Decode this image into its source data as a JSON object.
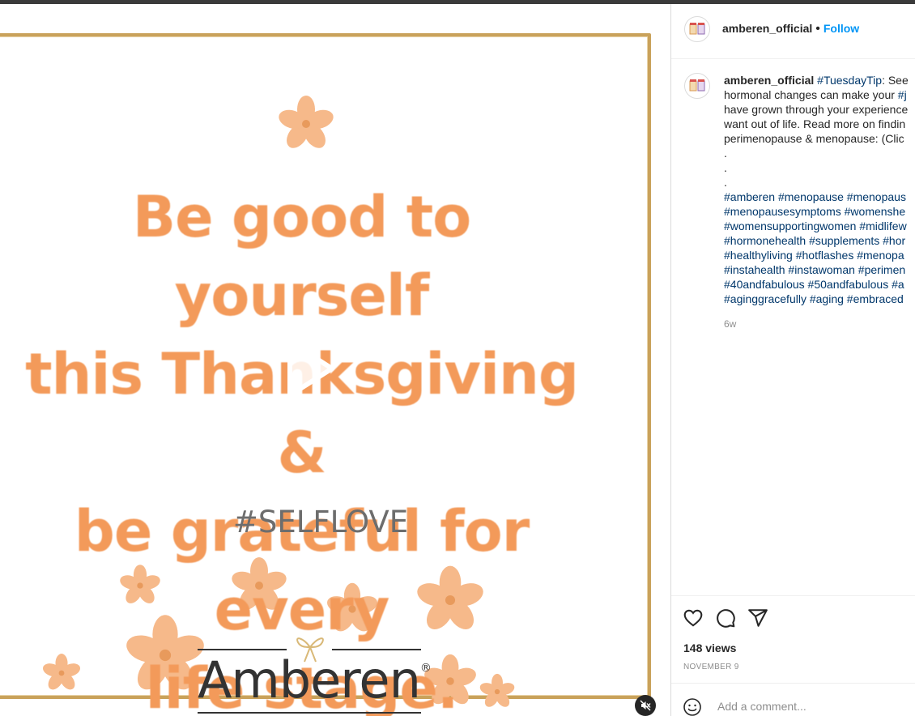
{
  "post": {
    "username": "amberen_official",
    "separator": "•",
    "follow_label": "Follow"
  },
  "media": {
    "quote_lines": [
      "Be good to yourself",
      "this Thanksgiving &",
      "be grateful for every",
      "life stage."
    ],
    "hashtag": "#SELFLOVE",
    "logo_text": "Amberen",
    "logo_mark": "®",
    "play_icon": "play-icon",
    "mute_icon": "muted-speaker-icon"
  },
  "caption": {
    "username": "amberen_official",
    "lines": [
      [
        {
          "t": "#TuesdayTip",
          "tag": true
        },
        {
          "t": ": See ",
          "tag": false
        }
      ],
      [
        {
          "t": "hormonal changes can make your ",
          "tag": false
        },
        {
          "t": "#j",
          "tag": true
        }
      ],
      [
        {
          "t": "have grown through your experience",
          "tag": false
        }
      ],
      [
        {
          "t": "want out of life. Read more on findin",
          "tag": false
        }
      ],
      [
        {
          "t": "perimenopause & menopause: (Clic",
          "tag": false
        }
      ],
      [
        {
          "t": ".",
          "tag": false
        }
      ],
      [
        {
          "t": ".",
          "tag": false
        }
      ],
      [
        {
          "t": ".",
          "tag": false
        }
      ],
      [
        {
          "t": "#amberen",
          "tag": true
        },
        {
          "t": " ",
          "tag": false
        },
        {
          "t": "#menopause",
          "tag": true
        },
        {
          "t": " ",
          "tag": false
        },
        {
          "t": "#menopaus",
          "tag": true
        }
      ],
      [
        {
          "t": "#menopausesymptoms",
          "tag": true
        },
        {
          "t": " ",
          "tag": false
        },
        {
          "t": "#womenshe",
          "tag": true
        }
      ],
      [
        {
          "t": "#womensupportingwomen",
          "tag": true
        },
        {
          "t": " ",
          "tag": false
        },
        {
          "t": "#midlifew",
          "tag": true
        }
      ],
      [
        {
          "t": "#hormonehealth",
          "tag": true
        },
        {
          "t": " ",
          "tag": false
        },
        {
          "t": "#supplements",
          "tag": true
        },
        {
          "t": " ",
          "tag": false
        },
        {
          "t": "#hor",
          "tag": true
        }
      ],
      [
        {
          "t": "#healthyliving",
          "tag": true
        },
        {
          "t": " ",
          "tag": false
        },
        {
          "t": "#hotflashes",
          "tag": true
        },
        {
          "t": " ",
          "tag": false
        },
        {
          "t": "#menopa",
          "tag": true
        }
      ],
      [
        {
          "t": "#instahealth",
          "tag": true
        },
        {
          "t": " ",
          "tag": false
        },
        {
          "t": "#instawoman",
          "tag": true
        },
        {
          "t": " ",
          "tag": false
        },
        {
          "t": "#perimen",
          "tag": true
        }
      ],
      [
        {
          "t": "#40andfabulous",
          "tag": true
        },
        {
          "t": " ",
          "tag": false
        },
        {
          "t": "#50andfabulous",
          "tag": true
        },
        {
          "t": " ",
          "tag": false
        },
        {
          "t": "#a",
          "tag": true
        }
      ],
      [
        {
          "t": "#aginggracefully",
          "tag": true
        },
        {
          "t": " ",
          "tag": false
        },
        {
          "t": "#aging",
          "tag": true
        },
        {
          "t": " ",
          "tag": false
        },
        {
          "t": "#embraced",
          "tag": true
        }
      ]
    ],
    "age": "6w"
  },
  "actions": {
    "like_icon": "heart-icon",
    "comment_icon": "comment-icon",
    "share_icon": "share-icon"
  },
  "stats": {
    "views": "148 views",
    "date": "NOVEMBER 9"
  },
  "comment": {
    "placeholder": "Add a comment...",
    "emoji_icon": "emoji-icon"
  },
  "colors": {
    "link_blue": "#0095f6",
    "hashtag_blue": "#00376b",
    "quote_orange": "#f39a5a",
    "frame_gold": "#c9a25b"
  }
}
